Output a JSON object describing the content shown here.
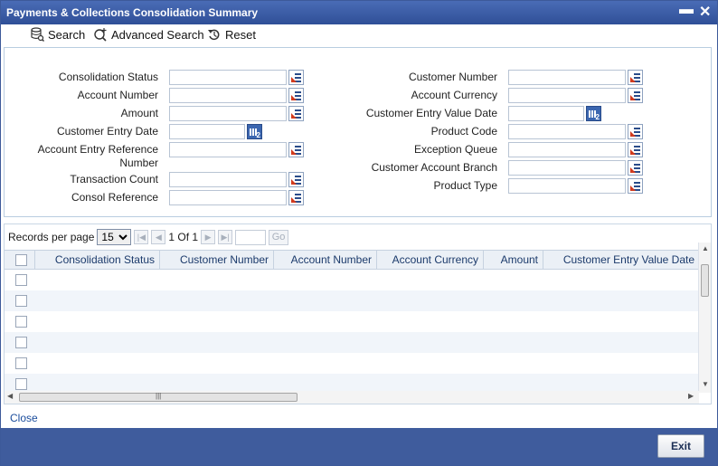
{
  "window": {
    "title": "Payments & Collections Consolidation Summary",
    "minimize": "▬",
    "close": "✕"
  },
  "toolbar": {
    "search": "Search",
    "advanced_search": "Advanced Search",
    "reset": "Reset"
  },
  "criteria": {
    "left": [
      {
        "label": "Consolidation Status",
        "value": "",
        "button": "lov"
      },
      {
        "label": "Account Number",
        "value": "",
        "button": "lov"
      },
      {
        "label": "Amount",
        "value": "",
        "button": "lov"
      },
      {
        "label": "Customer Entry Date",
        "value": "",
        "button": "calendar"
      },
      {
        "label": "Account Entry Reference",
        "label2": "Number",
        "value": "",
        "button": "lov"
      },
      {
        "label": "Transaction Count",
        "value": "",
        "button": "lov"
      },
      {
        "label": "Consol Reference",
        "value": "",
        "button": "lov"
      }
    ],
    "right": [
      {
        "label": "Customer Number",
        "value": "",
        "button": "lov"
      },
      {
        "label": "Account Currency",
        "value": "",
        "button": "lov"
      },
      {
        "label": "Customer Entry Value Date",
        "value": "",
        "button": "calendar"
      },
      {
        "label": "Product Code",
        "value": "",
        "button": "lov"
      },
      {
        "label": "Exception Queue",
        "value": "",
        "button": "lov"
      },
      {
        "label": "Customer Account Branch",
        "value": "",
        "button": "lov"
      },
      {
        "label": "Product Type",
        "value": "",
        "button": "lov"
      }
    ]
  },
  "pager": {
    "records_label": "Records per page",
    "per_page": "15",
    "page_text": "1 Of 1",
    "go": "Go",
    "page_input": ""
  },
  "table": {
    "columns": [
      "Consolidation Status",
      "Customer Number",
      "Account Number",
      "Account Currency",
      "Amount",
      "Customer Entry Value Date"
    ],
    "rows": [
      [],
      [],
      [],
      [],
      [],
      []
    ]
  },
  "footer": {
    "close_link": "Close",
    "exit": "Exit"
  },
  "colors": {
    "titlebar": "#3a5ba5",
    "footer": "#3f5c9d",
    "link": "#1a4c9c"
  }
}
